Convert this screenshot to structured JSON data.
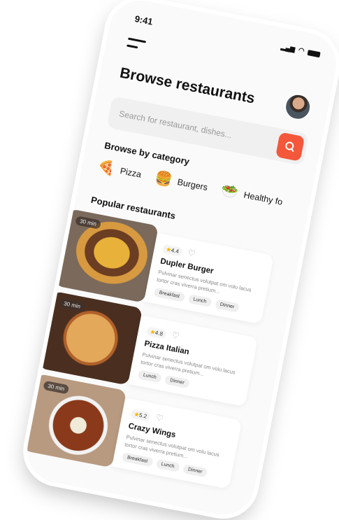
{
  "status": {
    "time": "9:41"
  },
  "header": {
    "title": "Browse restaurants"
  },
  "search": {
    "placeholder": "Search for restaurant, dishes..."
  },
  "categories": {
    "heading": "Browse by category",
    "items": [
      {
        "label": "Pizza",
        "icon": "🍕"
      },
      {
        "label": "Burgers",
        "icon": "🍔"
      },
      {
        "label": "Healthy fo",
        "icon": "🥗"
      }
    ]
  },
  "popular": {
    "heading": "Popular restaurants",
    "items": [
      {
        "time": "30 min",
        "rating": "4.4",
        "name": "Dupler Burger",
        "desc": "Pulvinar senectus volutpat om volu lacus tortor cras viverra pretium...",
        "tags": [
          "Breakfast",
          "Lunch",
          "Dinner"
        ]
      },
      {
        "time": "30 min",
        "rating": "4.8",
        "name": "Pizza Italian",
        "desc": "Pulvinar senectus volutpat om volu lacus tortor cras viverra pretium...",
        "tags": [
          "Lunch",
          "Dinner"
        ]
      },
      {
        "time": "30 min",
        "rating": "5.2",
        "name": "Crazy Wings",
        "desc": "Pulvinar senectus volutpat om volu lacus tortor cras viverra pretium...",
        "tags": [
          "Breakfast",
          "Lunch",
          "Dinner"
        ]
      }
    ]
  },
  "colors": {
    "accent": "#f4573a"
  }
}
